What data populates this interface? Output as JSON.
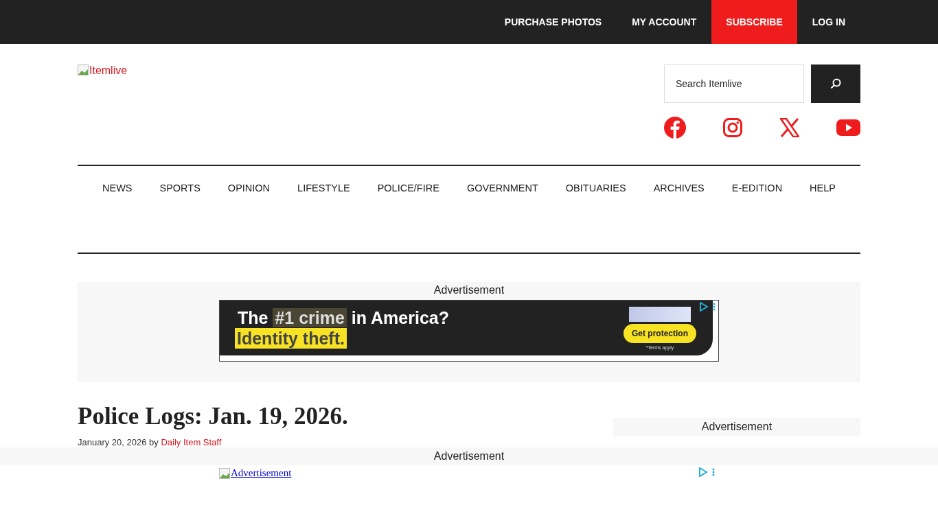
{
  "top_bar": {
    "links": [
      {
        "label": "PURCHASE PHOTOS",
        "kind": "link"
      },
      {
        "label": "MY ACCOUNT",
        "kind": "link"
      },
      {
        "label": "SUBSCRIBE",
        "kind": "highlight"
      },
      {
        "label": "LOG IN",
        "kind": "link"
      }
    ]
  },
  "header": {
    "logo_alt": "Itemlive",
    "search": {
      "placeholder": "Search Itemlive"
    }
  },
  "nav": {
    "items": [
      "NEWS",
      "SPORTS",
      "OPINION",
      "LIFESTYLE",
      "POLICE/FIRE",
      "GOVERNMENT",
      "OBITUARIES",
      "ARCHIVES",
      "E-EDITION",
      "HELP"
    ]
  },
  "ad_banner": {
    "label": "Advertisement",
    "headline_parts": [
      {
        "text": "The ",
        "highlight": false
      },
      {
        "text": "#1 crime",
        "highlight": true
      },
      {
        "text": " in America?",
        "highlight": false
      }
    ],
    "subline": "Identity theft.",
    "cta": "Get protection",
    "fine_print": "*Terms apply"
  },
  "article": {
    "title": "Police Logs: Jan. 19, 2026.",
    "date_by": "January 20, 2026 by",
    "author": "Daily Item Staff"
  },
  "sidebar": {
    "ad_label": "Advertisement"
  },
  "sticky_ad": {
    "label": "Advertisement",
    "image_alt": "Advertisement"
  }
}
